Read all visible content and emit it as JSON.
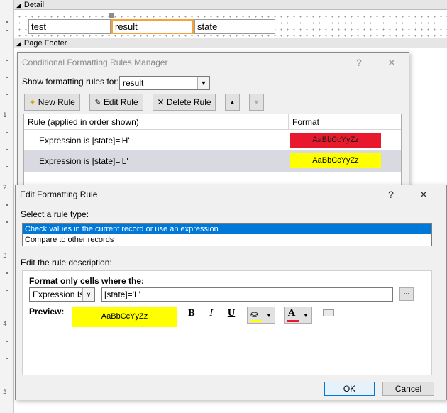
{
  "design": {
    "detail_label": "Detail",
    "page_footer_label": "Page Footer",
    "fields": [
      "test",
      "result",
      "state"
    ],
    "ruler_numbers": [
      "1",
      "2",
      "3",
      "4",
      "5"
    ]
  },
  "manager": {
    "title": "Conditional Formatting Rules Manager",
    "help": "?",
    "close": "✕",
    "show_label": "Show formatting rules for:",
    "show_value": "result",
    "new_rule": "New Rule",
    "edit_rule": "Edit Rule",
    "delete_rule": "Delete Rule",
    "col_rule": "Rule (applied in order shown)",
    "col_format": "Format",
    "rules": [
      {
        "expr": "Expression is [state]='H'",
        "sample": "AaBbCcYyZz",
        "color": "#e8192c"
      },
      {
        "expr": "Expression is [state]='L'",
        "sample": "AaBbCcYyZz",
        "color": "#ffff00"
      }
    ]
  },
  "edit": {
    "title": "Edit Formatting Rule",
    "help": "?",
    "close": "✕",
    "select_type_label": "Select a rule type:",
    "types": [
      "Check values in the current record or use an expression",
      "Compare to other records"
    ],
    "desc_label": "Edit the rule description:",
    "format_only_label": "Format only cells where the:",
    "condition_type": "Expression Is",
    "expression": "[state]='L'",
    "ellipsis": "...",
    "preview_label": "Preview:",
    "preview_text": "AaBbCcYyZz",
    "preview_color": "#ffff00",
    "bold": "B",
    "italic": "I",
    "underline": "U",
    "ok": "OK",
    "cancel": "Cancel"
  }
}
